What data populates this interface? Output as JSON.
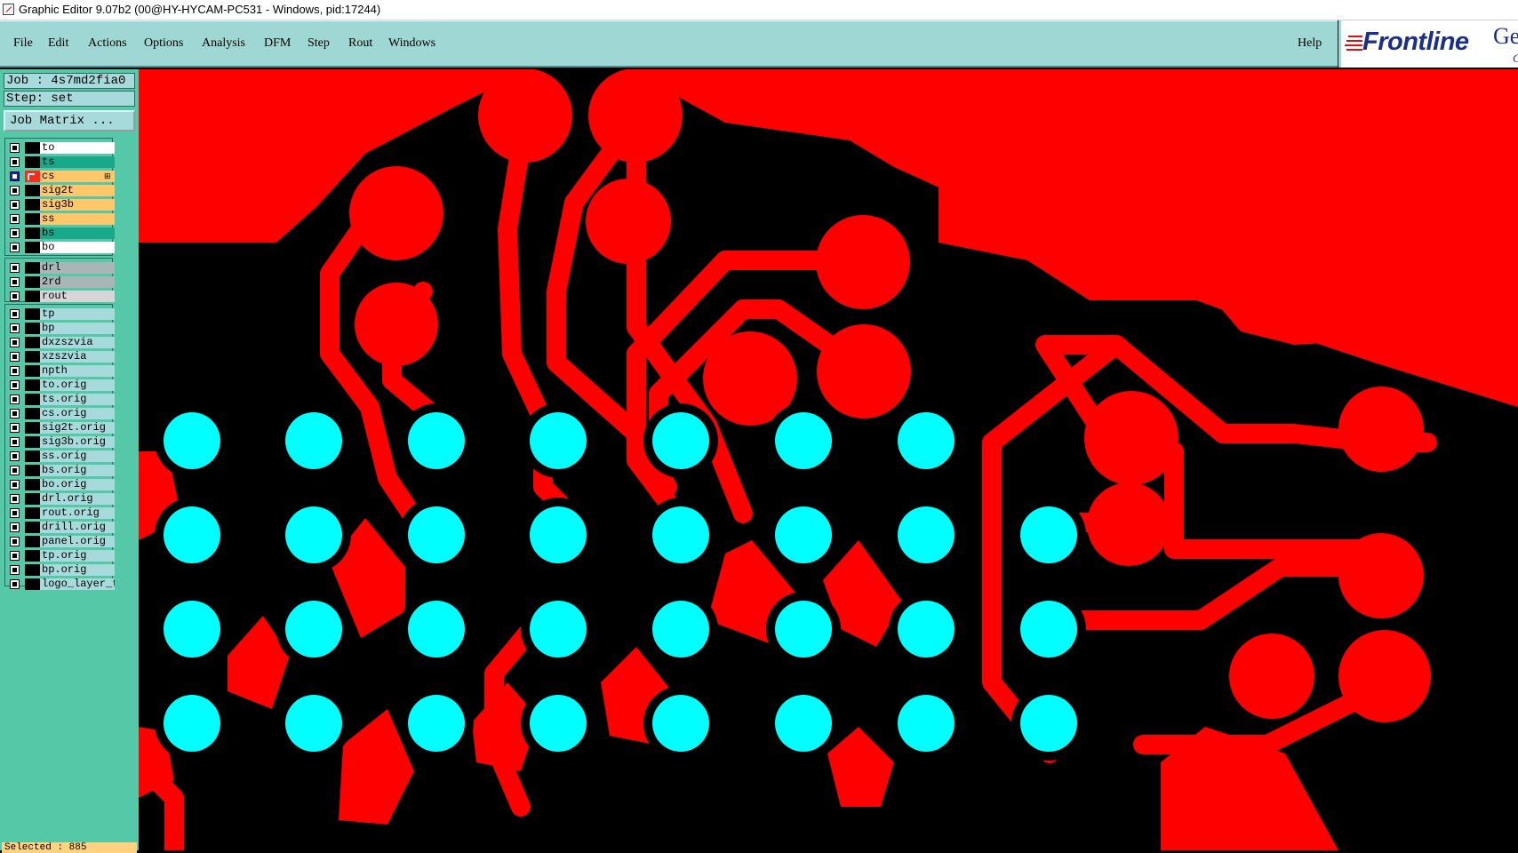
{
  "window": {
    "title": "Graphic Editor 9.07b2 (00@HY-HYCAM-PC531 - Windows, pid:17244)"
  },
  "menubar": {
    "items": [
      "File",
      "Edit",
      "Actions",
      "Options",
      "Analysis",
      "DFM",
      "Step",
      "Rout",
      "Windows"
    ],
    "help": "Help"
  },
  "logo": {
    "text": "Frontline",
    "partial1": "Ge",
    "partial2": "G"
  },
  "job": {
    "label": "Job : 4s7md2fia0",
    "step": "Step: set",
    "matrix_button": "Job Matrix ..."
  },
  "layers": {
    "board": [
      {
        "name": "to",
        "color": "#ffffff"
      },
      {
        "name": "ts",
        "color": "#1aa88a"
      },
      {
        "name": "cs",
        "color": "#ffc76a",
        "active": true,
        "marker": "⊞"
      },
      {
        "name": "sig2t",
        "color": "#ffc76a"
      },
      {
        "name": "sig3b",
        "color": "#ffc76a"
      },
      {
        "name": "ss",
        "color": "#ffc76a"
      },
      {
        "name": "bs",
        "color": "#1aa88a"
      },
      {
        "name": "bo",
        "color": "#ffffff"
      }
    ],
    "drill": [
      {
        "name": "drl",
        "color": "#a9b6b8"
      },
      {
        "name": "2rd",
        "color": "#a9b6b8"
      },
      {
        "name": "rout",
        "color": "#d6d6d6"
      }
    ],
    "misc": [
      {
        "name": "tp",
        "color": "#a7dadb"
      },
      {
        "name": "bp",
        "color": "#a7dadb"
      },
      {
        "name": "dxzszvia",
        "color": "#a7dadb"
      },
      {
        "name": "xzszvia",
        "color": "#a7dadb"
      },
      {
        "name": "npth",
        "color": "#a7dadb"
      },
      {
        "name": "to.orig",
        "color": "#a7dadb"
      },
      {
        "name": "ts.orig",
        "color": "#a7dadb"
      },
      {
        "name": "cs.orig",
        "color": "#a7dadb"
      },
      {
        "name": "sig2t.orig",
        "color": "#a7dadb"
      },
      {
        "name": "sig3b.orig",
        "color": "#a7dadb"
      },
      {
        "name": "ss.orig",
        "color": "#a7dadb"
      },
      {
        "name": "bs.orig",
        "color": "#a7dadb"
      },
      {
        "name": "bo.orig",
        "color": "#a7dadb"
      },
      {
        "name": "drl.orig",
        "color": "#a7dadb"
      },
      {
        "name": "rout.orig",
        "color": "#a7dadb"
      },
      {
        "name": "drill.orig",
        "color": "#a7dadb"
      },
      {
        "name": "panel.orig",
        "color": "#a7dadb"
      },
      {
        "name": "tp.orig",
        "color": "#a7dadb"
      },
      {
        "name": "bp.orig",
        "color": "#a7dadb"
      },
      {
        "name": "logo_layer_t",
        "color": "#a7dadb"
      }
    ]
  },
  "status": {
    "selected": "Selected : 885"
  },
  "canvas": {
    "copper_color": "#ff0000",
    "pad_color": "#00ffff",
    "background": "#000000"
  }
}
